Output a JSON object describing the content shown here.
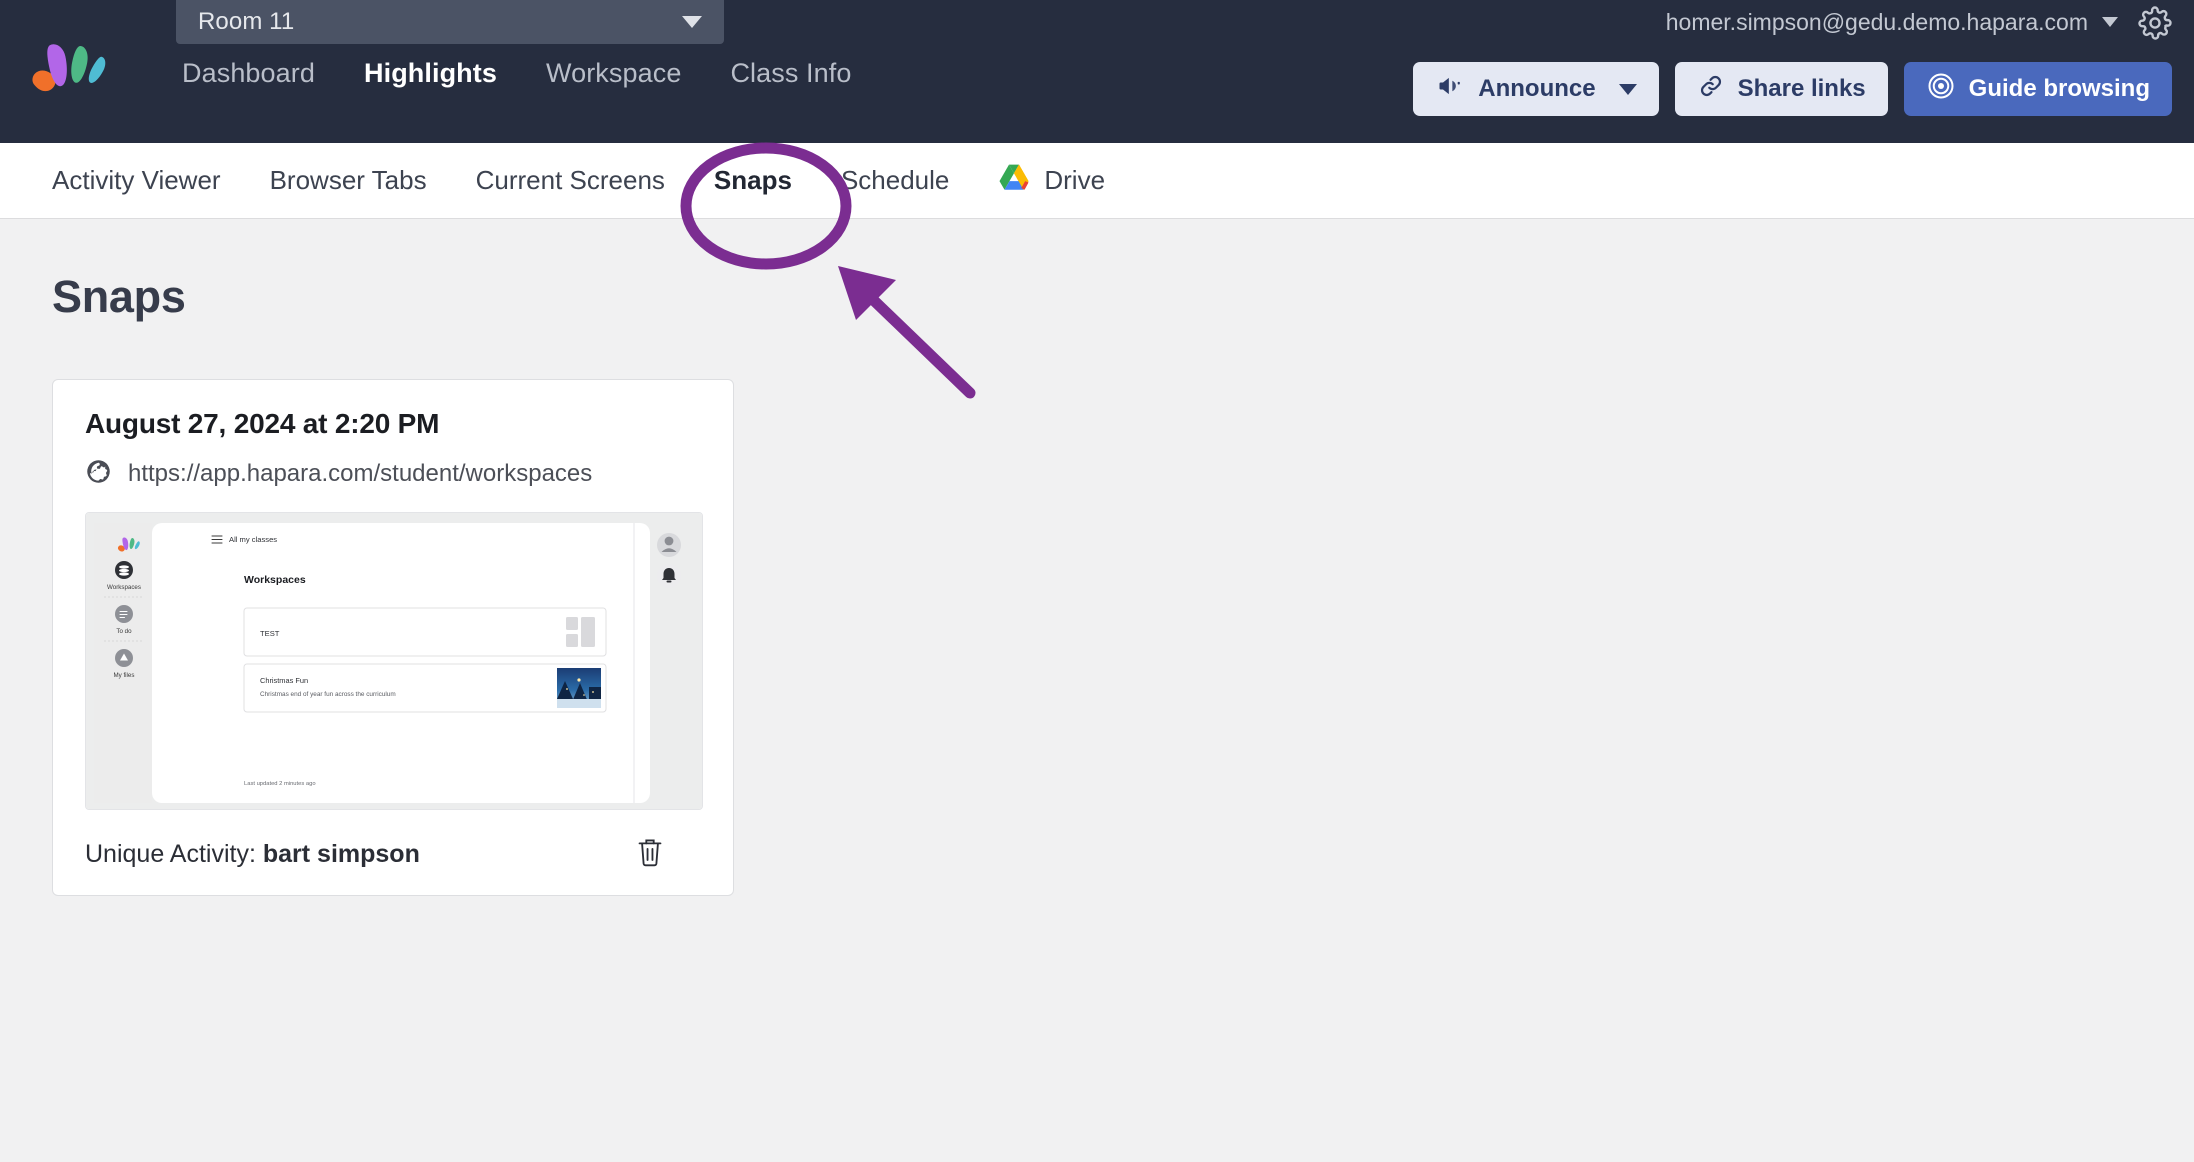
{
  "header": {
    "room_selector": {
      "label": "Room 11",
      "icon": "chevron-down-icon"
    },
    "logo": "hapara-logo",
    "nav": [
      {
        "label": "Dashboard",
        "active": false
      },
      {
        "label": "Highlights",
        "active": true
      },
      {
        "label": "Workspace",
        "active": false
      },
      {
        "label": "Class Info",
        "active": false
      }
    ],
    "account": {
      "email": "homer.simpson@gedu.demo.hapara.com",
      "caret_icon": "chevron-down-icon",
      "settings_icon": "gear-icon"
    },
    "actions": [
      {
        "label": "Announce",
        "icon": "megaphone-icon",
        "style": "light",
        "has_caret": true
      },
      {
        "label": "Share links",
        "icon": "link-icon",
        "style": "light",
        "has_caret": false
      },
      {
        "label": "Guide browsing",
        "icon": "target-icon",
        "style": "primary",
        "has_caret": false
      }
    ]
  },
  "subnav": {
    "tabs": [
      {
        "label": "Activity Viewer",
        "active": false,
        "icon": null
      },
      {
        "label": "Browser Tabs",
        "active": false,
        "icon": null
      },
      {
        "label": "Current Screens",
        "active": false,
        "icon": null
      },
      {
        "label": "Snaps",
        "active": true,
        "icon": null
      },
      {
        "label": "Schedule",
        "active": false,
        "icon": null
      },
      {
        "label": "Drive",
        "active": false,
        "icon": "google-drive-icon"
      }
    ]
  },
  "main": {
    "page_title": "Snaps",
    "snaps": [
      {
        "date": "August 27, 2024 at 2:20 PM",
        "url": "https://app.hapara.com/student/workspaces",
        "url_icon": "globe-icon",
        "activity_label": "Unique Activity:",
        "student_name": "bart simpson",
        "delete_icon": "trash-icon",
        "thumbnail": {
          "sidebar": {
            "logo": "hapara-logo",
            "items": [
              {
                "label": "Workspaces",
                "icon": "layers-icon",
                "active": true
              },
              {
                "label": "To do",
                "icon": "checklist-icon",
                "active": false
              },
              {
                "label": "My files",
                "icon": "drive-icon",
                "active": false
              }
            ]
          },
          "classes_tab": {
            "label": "All my classes",
            "icon": "hamburger-icon"
          },
          "heading": "Workspaces",
          "cards": [
            {
              "title": "TEST",
              "subtitle": "",
              "has_placeholder_thumb": true
            },
            {
              "title": "Christmas Fun",
              "subtitle": "Christmas end of year fun across the curriculum",
              "has_image_thumb": true
            }
          ],
          "footer": "Last updated 2 minutes ago",
          "avatar_icon": "user-avatar-icon",
          "bell_icon": "bell-icon"
        }
      }
    ]
  },
  "annotation": {
    "type": "highlight",
    "color": "#7b2d91",
    "shapes": [
      "ellipse-around-snaps-tab",
      "arrow-pointing-to-snaps-tab"
    ]
  },
  "colors": {
    "header_bg": "#262d3f",
    "room_select_bg": "#4b5365",
    "page_bg": "#f1f1f2",
    "primary_button": "#4a69bd",
    "light_button": "#e4e8f3",
    "annotation_purple": "#7b2d91"
  }
}
